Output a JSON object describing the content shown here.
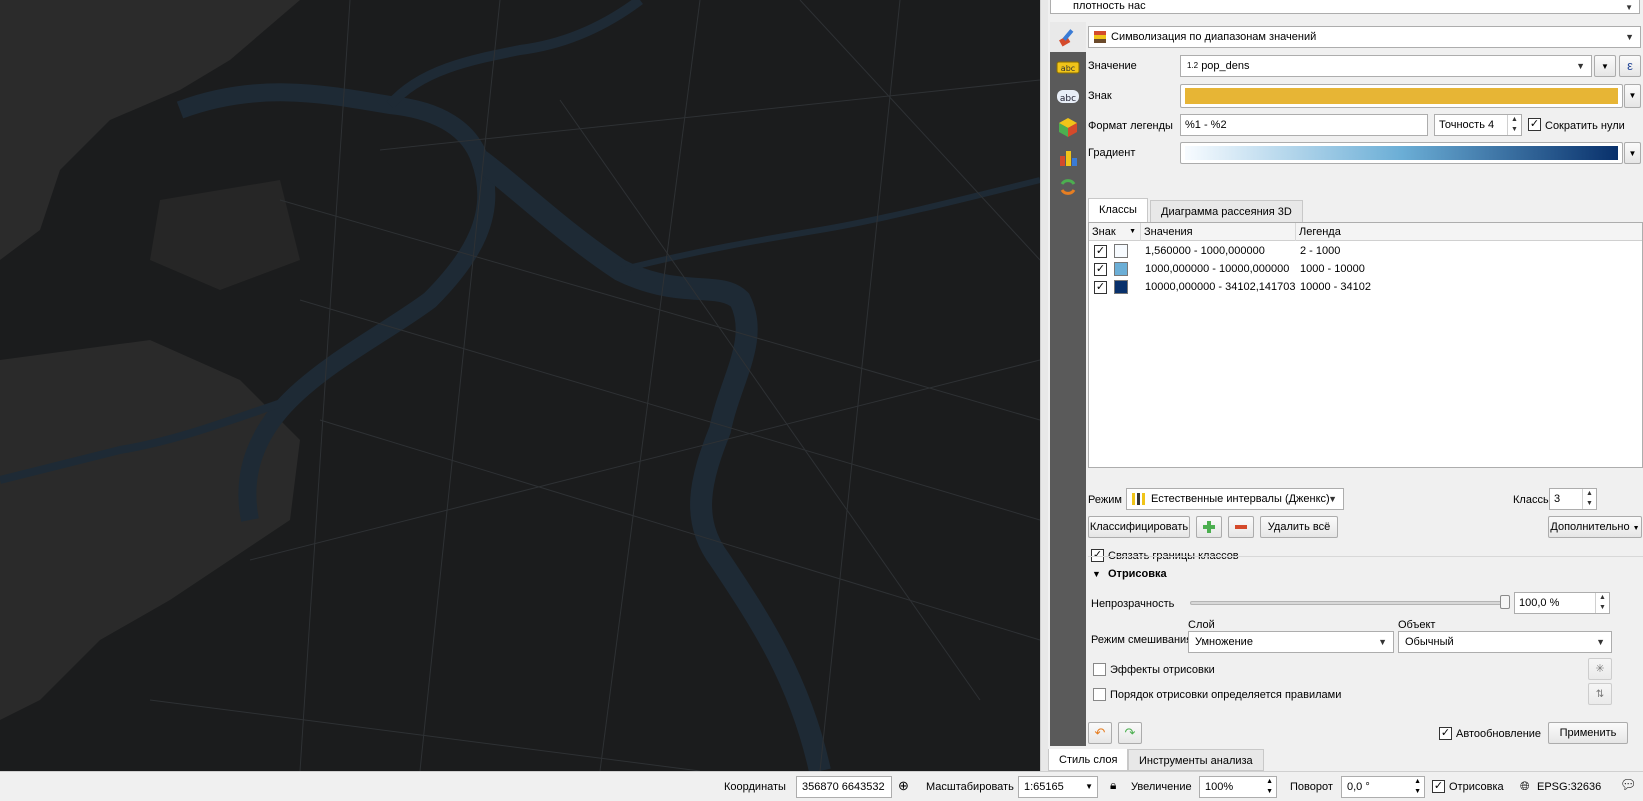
{
  "layer": {
    "name": "плотность нас"
  },
  "renderer": {
    "type_label": "Символизация по диапазонам значений"
  },
  "form": {
    "value_label": "Значение",
    "value_type": "1.2",
    "value_field": "pop_dens",
    "expression_glyph": "ε",
    "symbol_label": "Знак",
    "symbol_color": "#e7b535",
    "legend_format_label": "Формат легенды",
    "legend_format": "%1 - %2",
    "precision": "Точность 4",
    "trim_label": "Сократить нули",
    "trim_checked": true,
    "gradient_label": "Градиент",
    "gradient_colors": [
      "#f7fbff",
      "#08306b"
    ]
  },
  "tabs": [
    "Классы",
    "Диаграмма рассеяния 3D"
  ],
  "table": {
    "headers": [
      "Знак",
      "Значения",
      "Легенда"
    ],
    "rows": [
      {
        "checked": true,
        "color": "#f7fbff",
        "values": "1,560000 - 1000,000000",
        "legend": "2 - 1000"
      },
      {
        "checked": true,
        "color": "#6baed6",
        "values": "1000,000000 - 10000,000000",
        "legend": "1000 - 10000"
      },
      {
        "checked": true,
        "color": "#08306b",
        "values": "10000,000000 - 34102,141703",
        "legend": "10000 - 34102"
      }
    ]
  },
  "mode": {
    "label": "Режим",
    "value": "Естественные интервалы (Дженкс)",
    "classes_label": "Классы",
    "classes_value": "3"
  },
  "buttons": {
    "classify": "Классифицировать",
    "delete_all": "Удалить всё",
    "advanced": "Дополнительно"
  },
  "link_bounds": {
    "label": "Связать границы классов",
    "checked": true
  },
  "rendering": {
    "title": "Отрисовка",
    "opacity_label": "Непрозрачность",
    "opacity_value": "100,0 %",
    "opacity_fraction": 1.0,
    "blend_label": "Режим смешивания",
    "layer_label": "Слой",
    "layer_blend": "Умножение",
    "object_label": "Объект",
    "object_blend": "Обычный",
    "effects_label": "Эффекты отрисовки",
    "order_label": "Порядок отрисовки определяется правилами"
  },
  "footer": {
    "auto_update_label": "Автообновление",
    "auto_update": true,
    "apply": "Применить"
  },
  "dock_tabs": [
    "Стиль слоя",
    "Инструменты анализа"
  ],
  "status": {
    "coords_label": "Координаты",
    "coords": "356870 6643532",
    "scale_label": "Масштабировать",
    "scale": "1:65165",
    "magnifier_label": "Увеличение",
    "magnifier": "100%",
    "rotation_label": "Поворот",
    "rotation": "0,0 °",
    "render_label": "Отрисовка",
    "crs": "EPSG:32636"
  }
}
